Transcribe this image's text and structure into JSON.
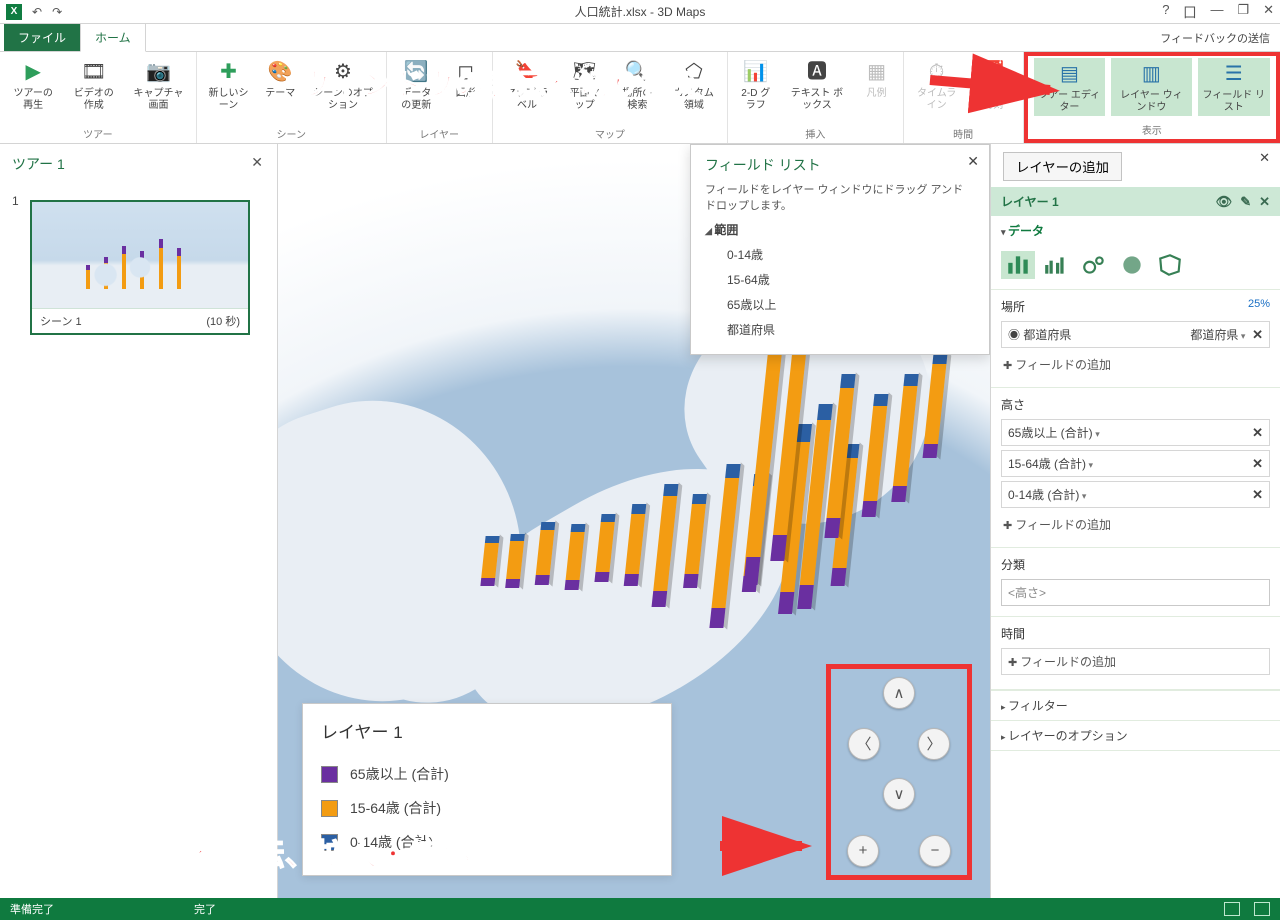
{
  "titlebar": {
    "title": "人口統計.xlsx - 3D Maps"
  },
  "win": {
    "help": "?",
    "opt": "囗",
    "min": "—",
    "restore": "❐",
    "close": "✕"
  },
  "qat": {
    "undo": "↶",
    "redo": "↷"
  },
  "tabs": {
    "file": "ファイル",
    "home": "ホーム",
    "feedback": "フィードバックの送信"
  },
  "ribbon": {
    "tour": {
      "label": "ツアー",
      "play": "ツアーの再生",
      "video": "ビデオの作成",
      "capture": "キャプチャ画面"
    },
    "scene": {
      "label": "シーン",
      "new": "新しいシーン",
      "themes": "テーマ",
      "options": "シーンのオプション"
    },
    "layer": {
      "label": "レイヤー",
      "refresh": "データの更新",
      "shape": "図形"
    },
    "map": {
      "label": "マップ",
      "labels": "マップ ラベル",
      "flat": "平面マップ",
      "find": "場所の検索",
      "custom": "カスタム領域"
    },
    "insert": {
      "label": "挿入",
      "chart": "2-D グラフ",
      "textbox": "テキスト ボックス",
      "legend": "凡例"
    },
    "time": {
      "label": "時間",
      "timeline": "タイムライン",
      "datetime": "日付と時刻"
    },
    "view": {
      "label": "表示",
      "tour_editor": "ツアー エディター",
      "layer_win": "レイヤー ウィンドウ",
      "field_list": "フィールド リスト"
    }
  },
  "tour_pane": {
    "title": "ツアー 1",
    "scene_name": "シーン 1",
    "scene_dur": "(10 秒)",
    "scene_num": "1"
  },
  "fieldlist": {
    "title": "フィールド リスト",
    "desc": "フィールドをレイヤー ウィンドウにドラッグ アンド ドロップします。",
    "root": "範囲",
    "items": [
      "0-14歳",
      "15-64歳",
      "65歳以上",
      "都道府県"
    ]
  },
  "legend": {
    "title": "レイヤー 1",
    "rows": [
      {
        "color": "#6a2fa0",
        "label": "65歳以上 (合計)"
      },
      {
        "color": "#f39c12",
        "label": "15-64歳 (合計)"
      },
      {
        "color": "#2b5fa3",
        "label": "0-14歳 (合計)"
      }
    ]
  },
  "layer_pane": {
    "add": "レイヤーの追加",
    "layer_name": "レイヤー 1",
    "data": "データ",
    "location": {
      "title": "場所",
      "pct": "25%",
      "field": "都道府県",
      "type": "都道府県",
      "add": "フィールドの追加"
    },
    "height": {
      "title": "高さ",
      "rows": [
        "65歳以上 (合計)",
        "15-64歳 (合計)",
        "0-14歳 (合計)"
      ],
      "add": "フィールドの追加"
    },
    "category": {
      "title": "分類",
      "value": "<高さ>"
    },
    "time": {
      "title": "時間",
      "add": "フィールドの追加"
    },
    "filter": "フィルター",
    "options": "レイヤーのオプション"
  },
  "status": {
    "left": "準備完了",
    "mid": "完了"
  },
  "anno": {
    "top": "ウィンドウの表示を切り替え",
    "bottom": "地図を回転、拡大・縮小"
  }
}
